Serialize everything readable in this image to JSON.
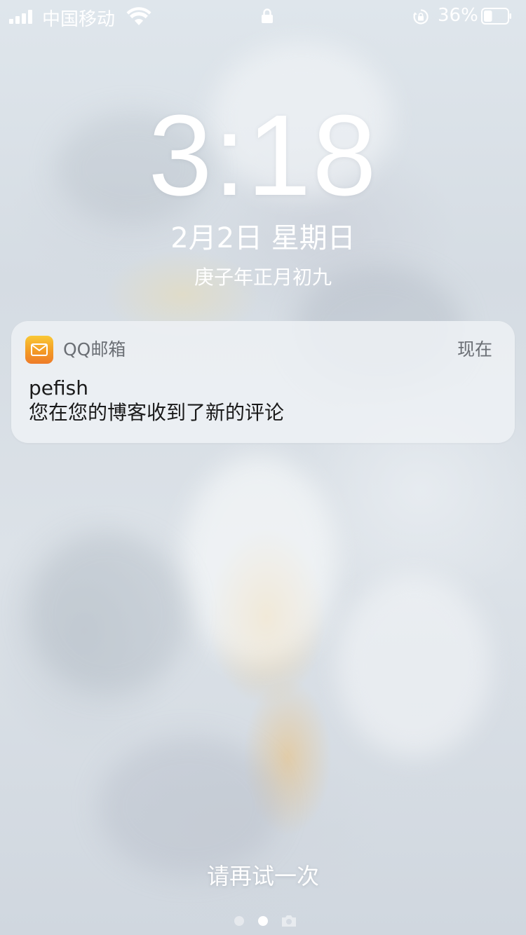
{
  "status_bar": {
    "carrier": "中国移动",
    "battery_percent": "36%",
    "battery_level": 0.36,
    "icons": [
      "signal-icon",
      "wifi-icon",
      "lock-icon",
      "rotation-lock-icon",
      "battery-icon"
    ]
  },
  "lock_screen": {
    "time": "3:18",
    "date": "2月2日 星期日",
    "lunar_date": "庚子年正月初九"
  },
  "notification": {
    "app_icon": "mail-icon",
    "app_name": "QQ邮箱",
    "time": "现在",
    "title": "pefish",
    "body": "您在您的博客收到了新的评论"
  },
  "bottom": {
    "hint": "请再试一次",
    "page_count": 3,
    "current_page": 2,
    "extra_icon": "camera-icon"
  },
  "colors": {
    "app_icon_gradient_top": "#f9c836",
    "app_icon_gradient_bottom": "#ee7b29",
    "text_primary": "#1a1a1a",
    "text_secondary": "#6b6f75"
  }
}
